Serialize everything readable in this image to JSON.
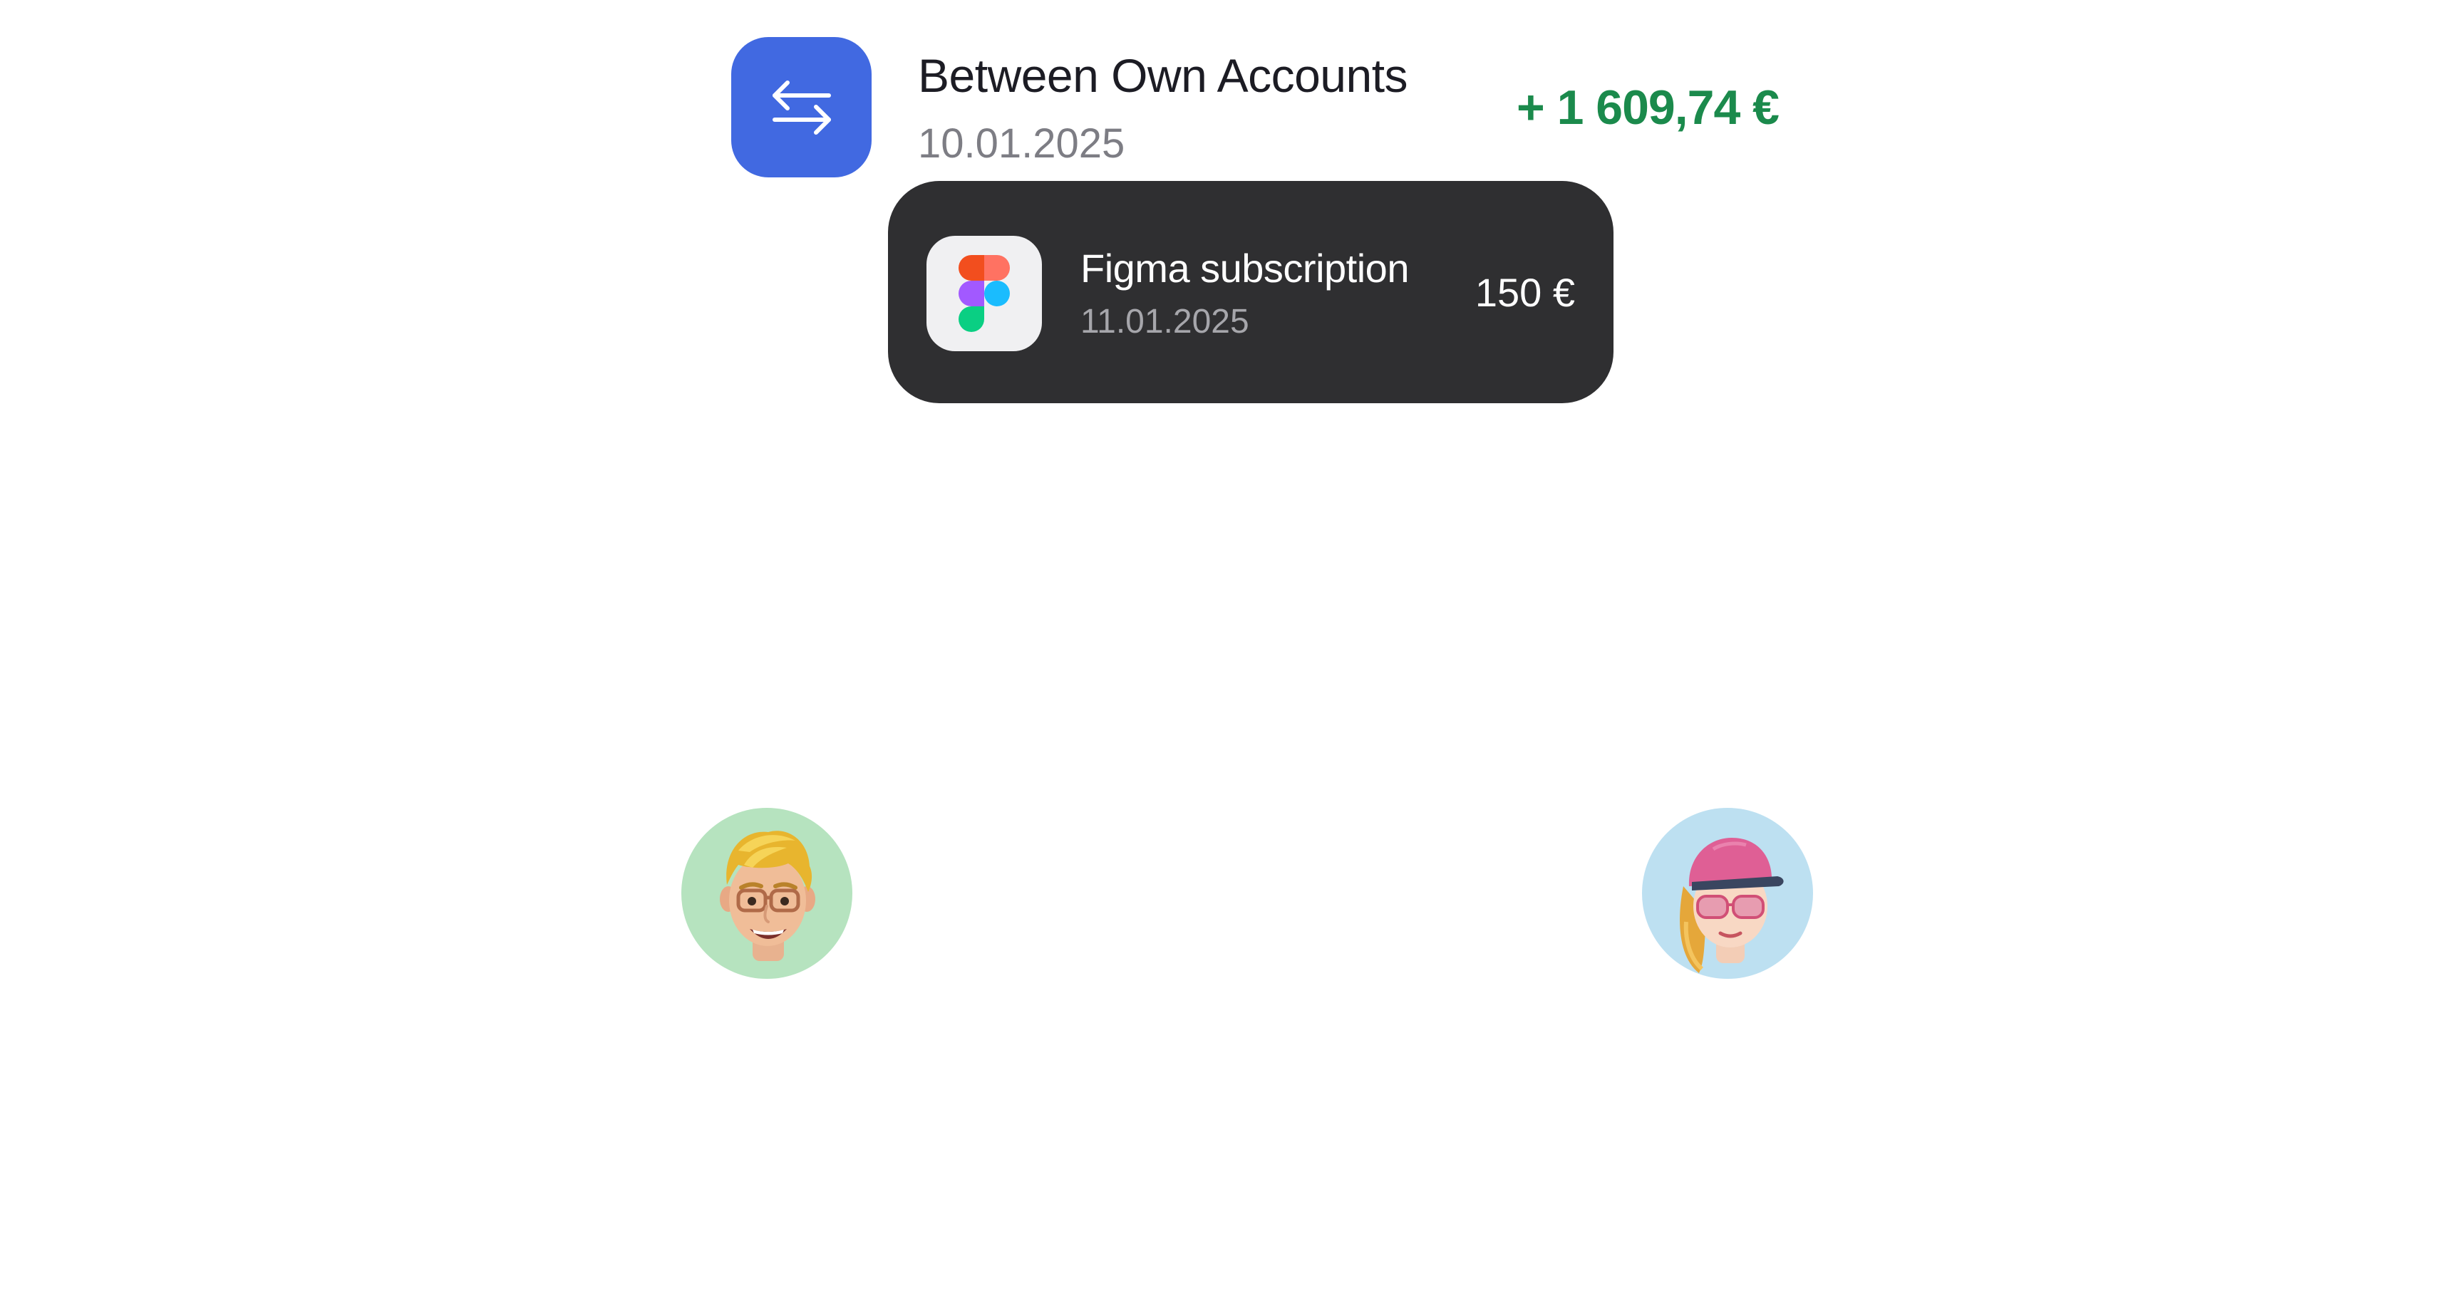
{
  "transaction": {
    "icon": "transfer-arrows-icon",
    "title": "Between Own Accounts",
    "date": "10.01.2025",
    "amount": "+ 1 609,74 €",
    "amount_color": "#1b8a4c",
    "icon_bg_color": "#4169e1"
  },
  "notification": {
    "icon": "figma-logo-icon",
    "title": "Figma subscription",
    "date": "11.01.2025",
    "amount": "150 €",
    "card_bg_color": "#2f2f31"
  },
  "avatars": [
    {
      "icon": "memoji-man-avatar",
      "bg_color": "#b6e3bf"
    },
    {
      "icon": "memoji-woman-cap-avatar",
      "bg_color": "#bde0f1"
    }
  ]
}
